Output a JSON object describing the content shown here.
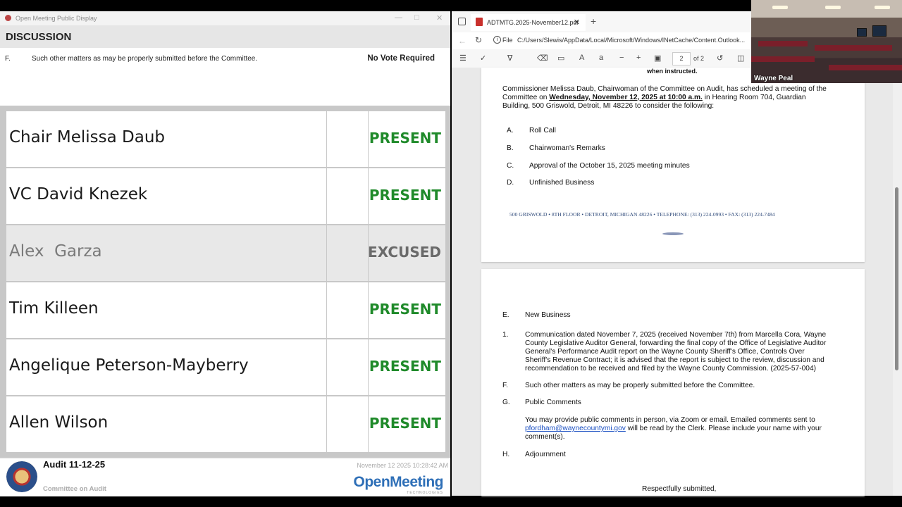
{
  "left_window": {
    "title": "Open Meeting Public Display",
    "section_header": "DISCUSSION",
    "item": {
      "letter": "F.",
      "text": "Such other matters as may be properly submitted before the Committee.",
      "vote_status": "No Vote Required"
    },
    "roll_call": [
      {
        "name": "Chair Melissa Daub",
        "status": "PRESENT"
      },
      {
        "name": "VC David Knezek",
        "status": "PRESENT"
      },
      {
        "name": "Alex  Garza",
        "status": "EXCUSED"
      },
      {
        "name": "Tim Killeen",
        "status": "PRESENT"
      },
      {
        "name": "Angelique Peterson-Mayberry",
        "status": "PRESENT"
      },
      {
        "name": "Allen Wilson",
        "status": "PRESENT"
      }
    ],
    "status_colors": {
      "present": "#1f8a2a",
      "excused": "#6a6a6a"
    },
    "footer": {
      "meeting": "Audit 11-12-25",
      "committee": "Committee on Audit",
      "timestamp": "November 12 2025 10:28:42 AM",
      "logo": "OpenMeeting",
      "logo_sub": "TECHNOLOGIES"
    }
  },
  "pdf_viewer": {
    "tab_title": "ADTMTG.2025-November12.pdf",
    "address_label": "File",
    "address_path": "C:/Users/Slewis/AppData/Local/Microsoft/Windows/INetCache/Content.Outlook...",
    "page_number": "2",
    "page_count": "of 2",
    "page1": {
      "top_fragment": "when instructed.",
      "intro_1": "Commissioner Melissa Daub, Chairwoman of the Committee on Audit, has scheduled a meeting of the",
      "intro_2a": "Committee on ",
      "intro_2b": "Wednesday, November 12, 2025 at 10:00 a.m.",
      "intro_2c": " in Hearing Room 704, Guardian",
      "intro_3": "Building, 500 Griswold, Detroit, MI 48226 to consider the following:",
      "agenda": [
        {
          "letter": "A.",
          "text": "Roll Call"
        },
        {
          "letter": "B.",
          "text": "Chairwoman's Remarks"
        },
        {
          "letter": "C.",
          "text": "Approval of the October 15, 2025 meeting minutes"
        },
        {
          "letter": "D.",
          "text": "Unfinished Business"
        }
      ],
      "address_line": "500 GRISWOLD • 8TH FLOOR • DETROIT, MICHIGAN 48226 • TELEPHONE: (313) 224-0993 • FAX: (313) 224-7484"
    },
    "page2": {
      "e_letter": "E.",
      "e_text": "New Business",
      "item1_num": "1.",
      "item1_lines": [
        "Communication dated November 7, 2025 (received November 7th) from Marcella Cora, Wayne",
        "County Legislative Auditor General, forwarding the final copy of the Office of Legislative Auditor",
        "General's Performance Audit report on the Wayne County Sheriff's Office, Controls Over",
        "Sheriff's Revenue Contract; it is advised that the report is subject to the review, discussion and",
        "recommendation to be received and filed by the Wayne County Commission. (2025-57-004)"
      ],
      "f_letter": "F.",
      "f_text": "Such other matters as may be properly submitted before the Committee.",
      "g_letter": "G.",
      "g_text": "Public Comments",
      "g_body_1": "You may provide public comments in person, via Zoom or email. Emailed comments sent to",
      "g_email": "pfordham@waynecountymi.gov",
      "g_body_2": " will be read by the Clerk. Please include your name with your",
      "g_body_3": "comment(s).",
      "h_letter": "H.",
      "h_text": "Adjournment",
      "closing": "Respectfully submitted,"
    }
  },
  "webcam": {
    "name": "Wayne Peal"
  }
}
